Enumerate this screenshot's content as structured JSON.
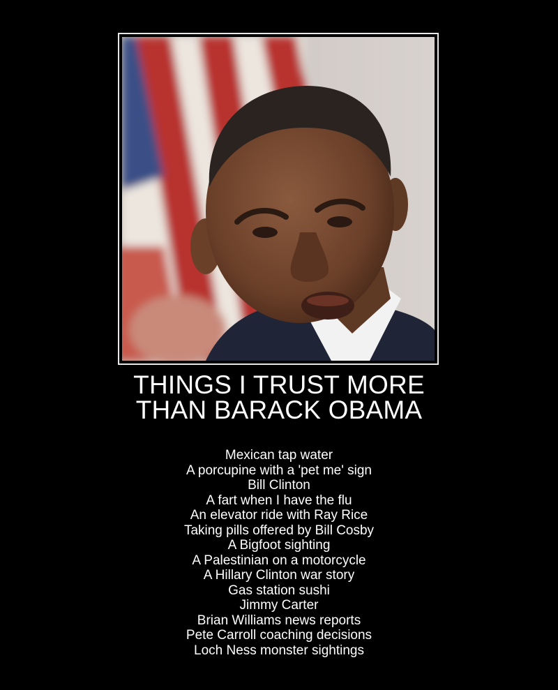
{
  "poster": {
    "title_line_1": "THINGS I TRUST MORE",
    "title_line_2": "THAN BARACK OBAMA",
    "items": [
      "Mexican tap water",
      "A porcupine with a 'pet me' sign",
      "Bill Clinton",
      "A fart when I have the flu",
      "An elevator ride with Ray Rice",
      "Taking pills offered by Bill Cosby",
      "A Bigfoot sighting",
      "A Palestinian on a motorcycle",
      "A Hillary Clinton war story",
      "Gas station sushi",
      "Jimmy Carter",
      "Brian Williams news reports",
      "Pete Carroll coaching decisions",
      "Loch Ness monster sightings"
    ]
  },
  "colors": {
    "background": "#000000",
    "text": "#ffffff",
    "frame_border": "#e8e8e8",
    "flag_red": "#b8302e",
    "flag_white": "#ece6df",
    "flag_blue": "#3a4f86",
    "suit": "#1f2436"
  }
}
